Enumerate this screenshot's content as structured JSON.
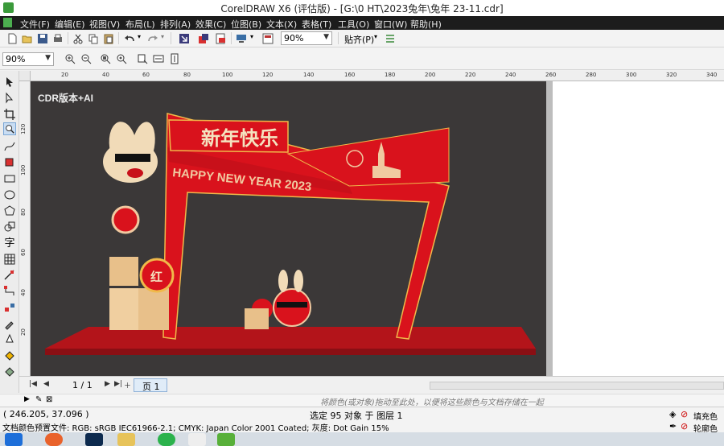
{
  "window": {
    "title": "CorelDRAW X6 (评估版) - [G:\\0 HT\\2023兔年\\兔年 23-11.cdr]"
  },
  "menu": [
    "文件(F)",
    "编辑(E)",
    "视图(V)",
    "布局(L)",
    "排列(A)",
    "效果(C)",
    "位图(B)",
    "文本(X)",
    "表格(T)",
    "工具(O)",
    "窗口(W)",
    "帮助(H)"
  ],
  "toolbar": {
    "zoom_value": "90%",
    "snap_label": "贴齐(P)"
  },
  "propertybar": {
    "zoom_value": "90%"
  },
  "hruler_ticks": [
    "20",
    "40",
    "60",
    "80",
    "100",
    "120",
    "140",
    "160",
    "180",
    "200",
    "220",
    "240",
    "260",
    "280",
    "300",
    "320",
    "340"
  ],
  "vruler_ticks": [
    "120",
    "100",
    "80",
    "60",
    "40",
    "20"
  ],
  "document": {
    "watermark": "CDR版本+AI",
    "headline": "新年快乐",
    "banner_text": "HAPPY NEW YEAR 2023",
    "badge_char": "红"
  },
  "pagebar": {
    "counter": "1 / 1",
    "page_tab": "页 1"
  },
  "hint": "将颜色(或对象)拖动至此处，以便将这些颜色与文档存储在一起",
  "status": {
    "coords": "( 246.205, 37.096 )",
    "selection": "选定 95 对象 于 图层 1",
    "profile": "文档颜色预置文件: RGB: sRGB IEC61966-2.1; CMYK: Japan Color 2001 Coated; 灰度: Dot Gain 15%",
    "fill_label": "填充色",
    "outline_label": "轮廓色"
  },
  "colors": {
    "artboard": "#3b3838",
    "arch_red": "#d9121c",
    "floor_red": "#b3141a",
    "gold": "#e8c08a",
    "menu_bg": "#1c1c1c"
  },
  "taskbar_icons": [
    "windows-start-icon",
    "chrome-icon",
    "photoshop-icon",
    "folder-icon",
    "wechat-icon",
    "file-icon",
    "coreldraw-icon"
  ]
}
